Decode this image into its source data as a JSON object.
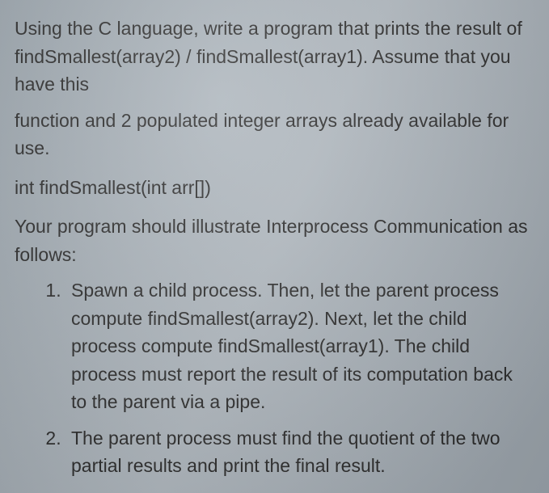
{
  "intro": {
    "p1": "Using the C language, write a program that prints the result of findSmallest(array2) / findSmallest(array1). Assume that you have this",
    "p2": "function and 2 populated integer arrays already available for use."
  },
  "signature": "int findSmallest(int arr[])",
  "instructions_lead": "Your program should illustrate Interprocess Communication as follows:",
  "steps": [
    "Spawn a child process. Then, let the parent process compute findSmallest(array2). Next, let the child process compute findSmallest(array1). The child process must report the result of its computation back to the parent via a pipe.",
    "The parent process must find the quotient of the two partial results and print the final result."
  ]
}
